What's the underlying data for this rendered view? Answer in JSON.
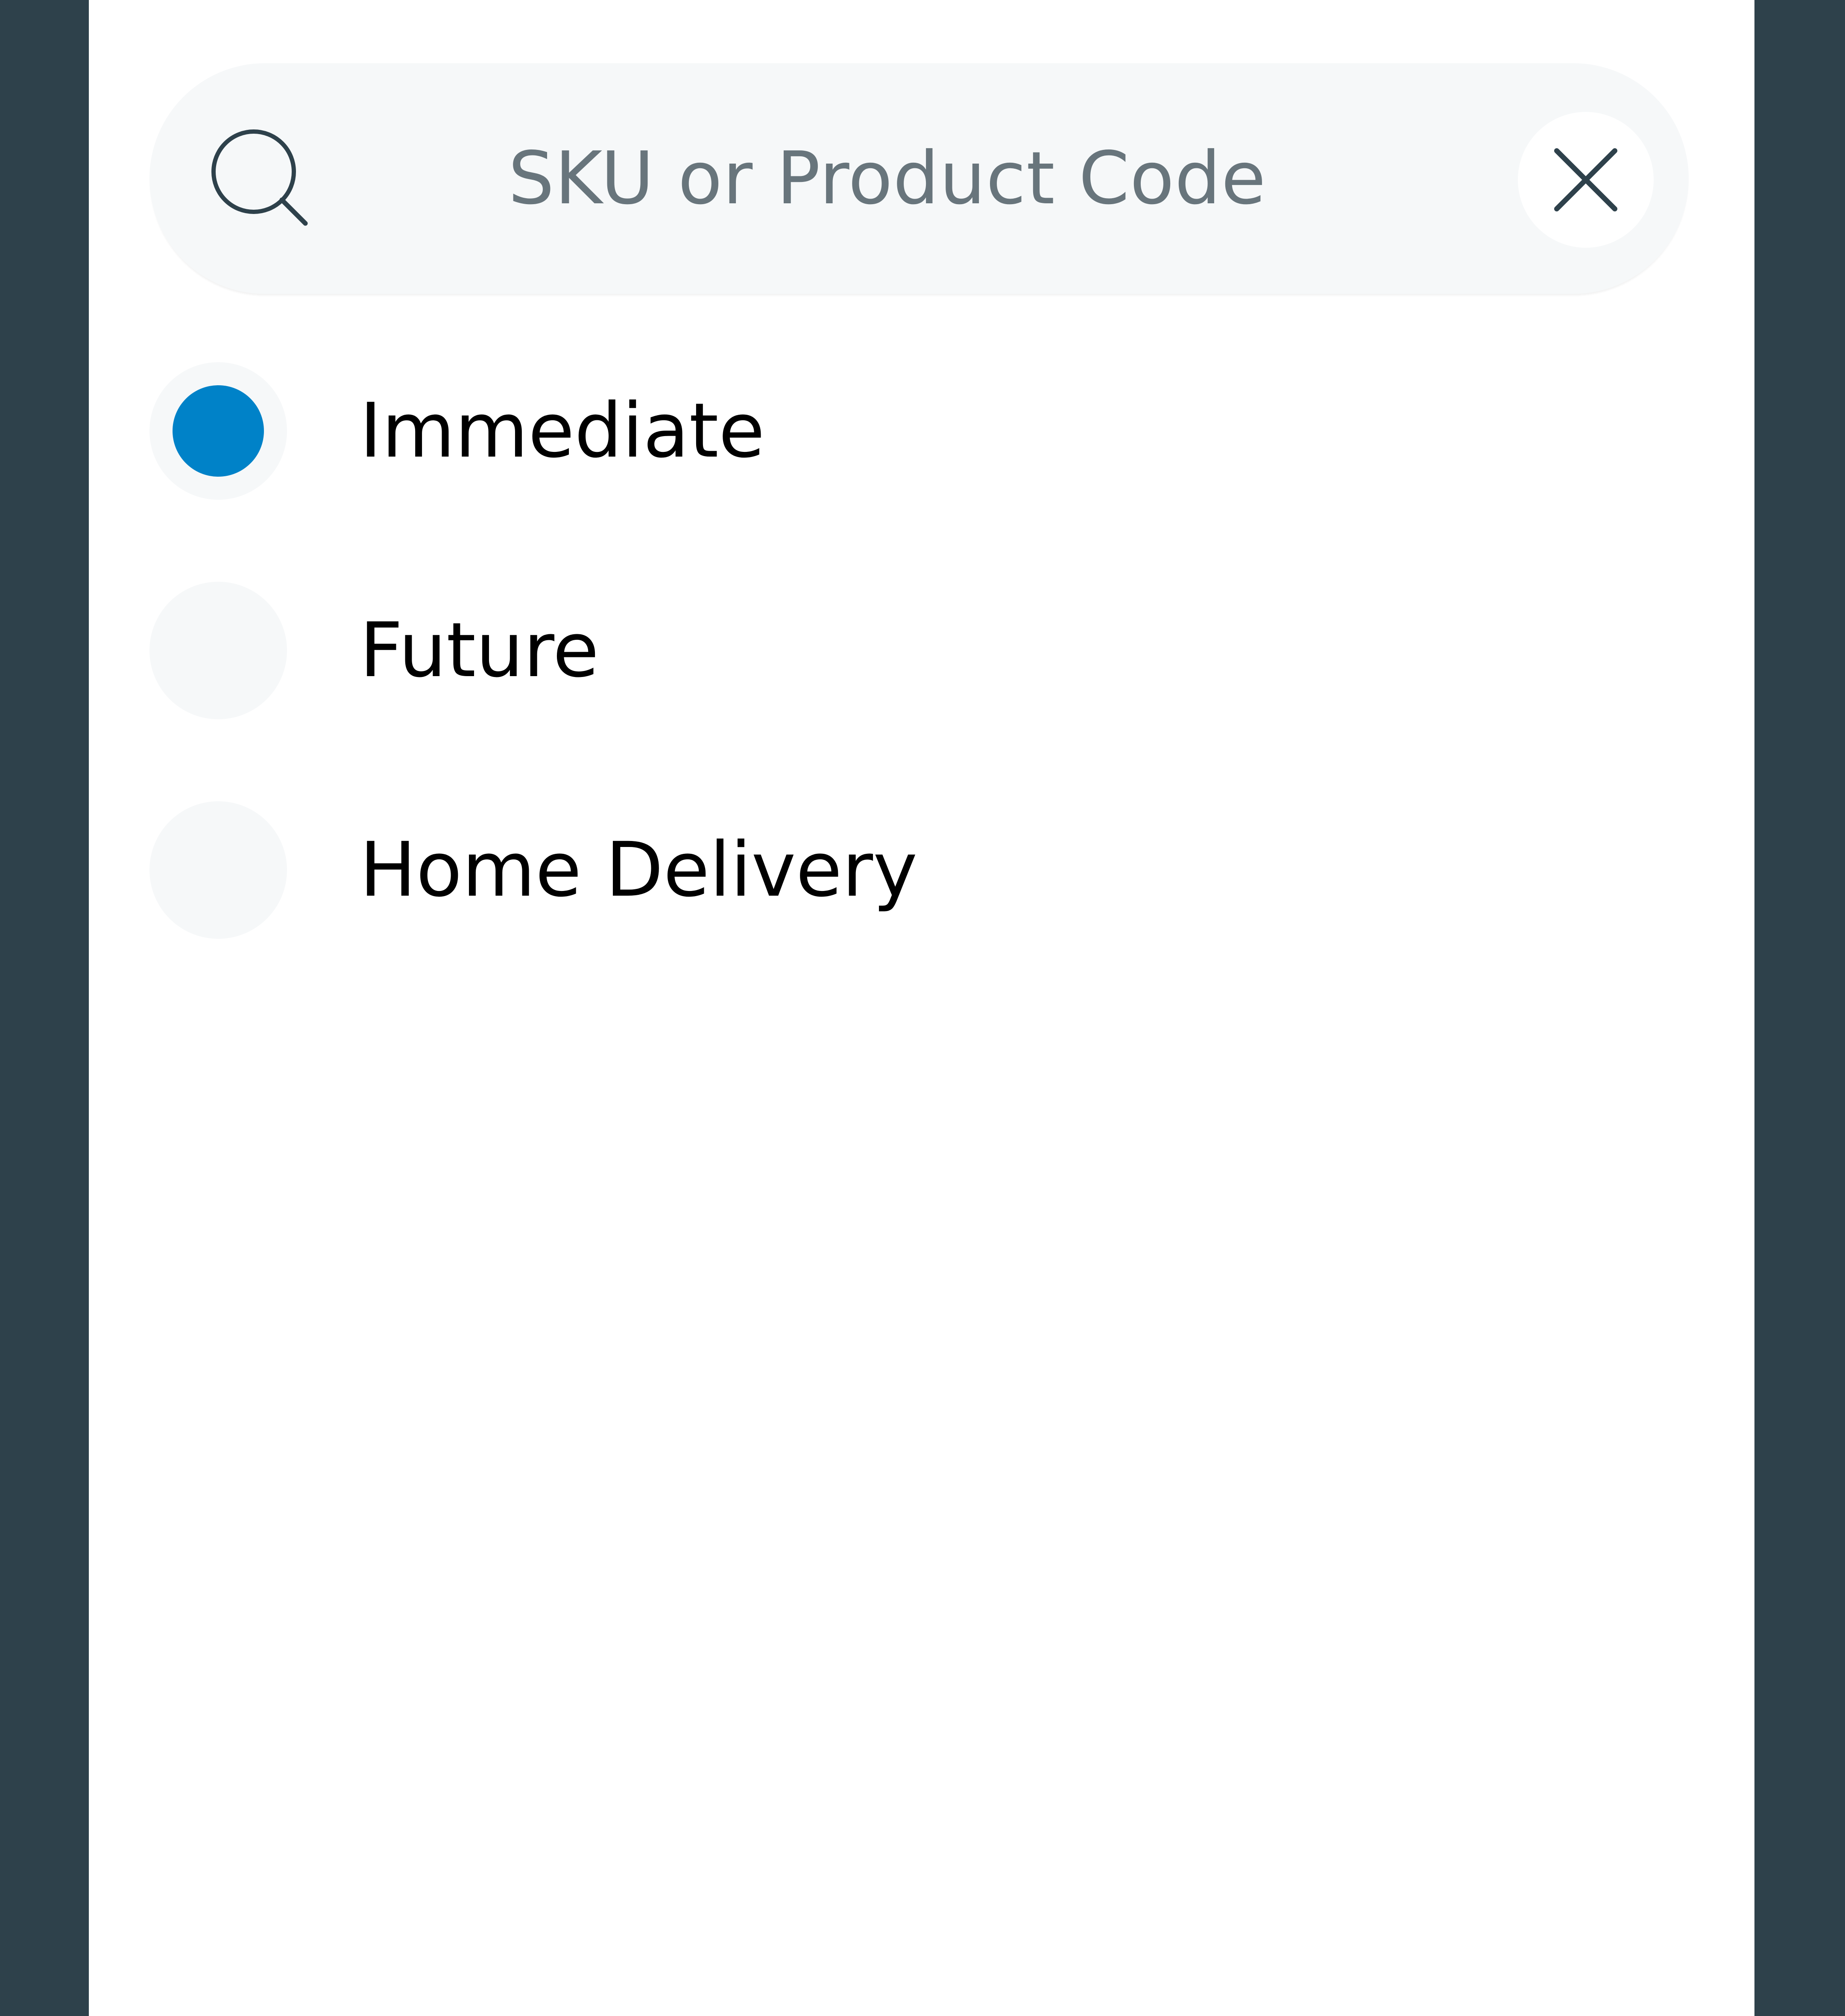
{
  "search": {
    "placeholder": "SKU or Product Code",
    "value": ""
  },
  "fulfillment_options": {
    "selected": "Immediate",
    "items": [
      {
        "label": "Immediate",
        "selected": true
      },
      {
        "label": "Future",
        "selected": false
      },
      {
        "label": "Home Delivery",
        "selected": false
      }
    ]
  },
  "colors": {
    "background": "#2e414b",
    "panel": "#ffffff",
    "field": "#f6f8f9",
    "accent": "#0082c8",
    "icon": "#2e414b",
    "placeholder": "#68757c",
    "text": "#000000"
  },
  "icons": {
    "search": "search-icon",
    "clear": "close-icon"
  }
}
